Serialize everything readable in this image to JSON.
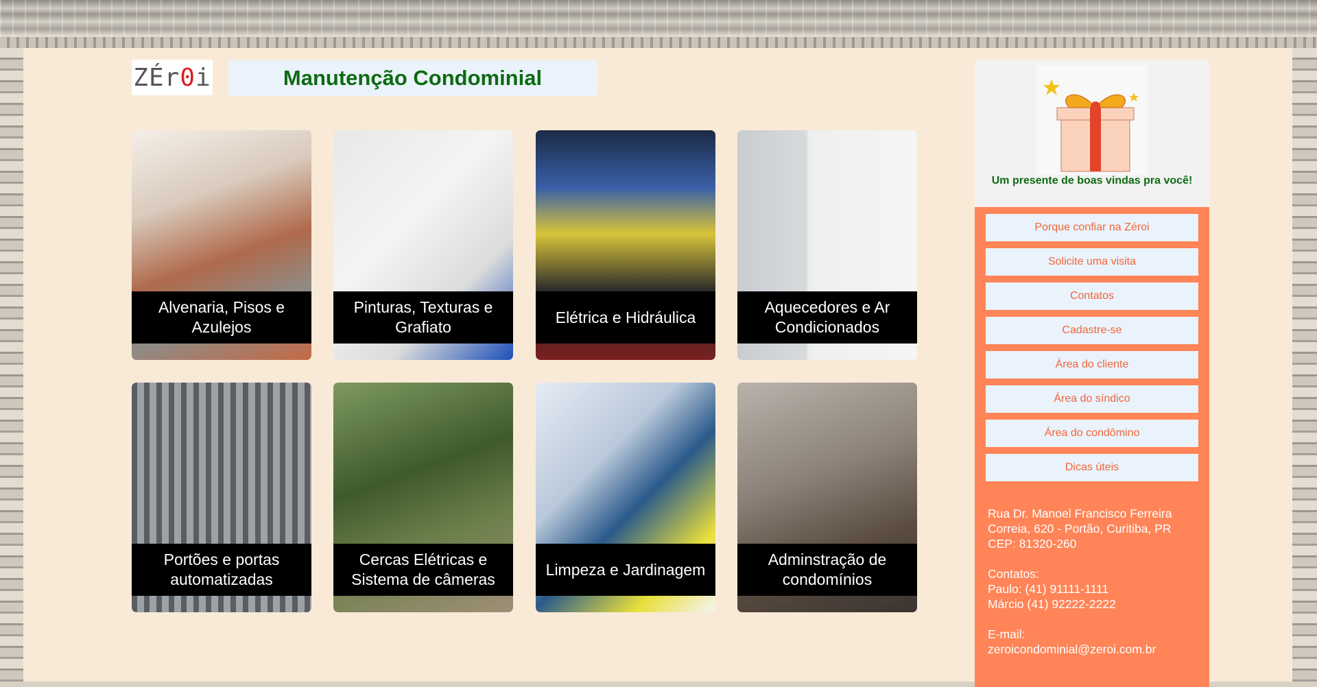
{
  "header": {
    "logo_text_pre": "ZÉr",
    "logo_text_zero": "0",
    "logo_text_post": "i",
    "title": "Manutenção Condominial"
  },
  "services": [
    {
      "label": "Alvenaria, Pisos e Azulejos"
    },
    {
      "label": "Pinturas, Texturas e Grafiato"
    },
    {
      "label": "Elétrica e Hidráulica"
    },
    {
      "label": "Aquecedores e Ar Condicionados"
    },
    {
      "label": "Portões e portas automatizadas"
    },
    {
      "label": "Cercas Elétricas e Sistema de câmeras"
    },
    {
      "label": "Limpeza e Jardinagem"
    },
    {
      "label": "Adminstração de condomínios"
    }
  ],
  "sidebar": {
    "gift_caption": "Um presente de boas vindas pra você!",
    "menu": [
      {
        "label": "Porque confiar na Zéroi"
      },
      {
        "label": "Solicite uma visita"
      },
      {
        "label": "Contatos"
      },
      {
        "label": "Cadastre-se"
      },
      {
        "label": "Área do cliente"
      },
      {
        "label": "Área do síndico"
      },
      {
        "label": "Área do condômino"
      },
      {
        "label": "Dicas úteis"
      }
    ],
    "address": {
      "line1": "Rua Dr. Manoel Francisco Ferreira",
      "line2": "Correia, 620 - Portão, Curitiba, PR",
      "line3": "CEP: 81320-260"
    },
    "contacts": {
      "heading": "Contatos:",
      "paulo": "Paulo: (41) 91111-1111",
      "marcio": "Márcio (41) 92222-2222"
    },
    "email": {
      "heading": "E-mail:",
      "value": "zeroicondominial@zeroi.com.br"
    }
  },
  "colors": {
    "page_bg": "#f9ead7",
    "title_green": "#0e6a12",
    "sidebar_orange": "#ff8457",
    "menu_text": "#f0653a",
    "menu_bg": "#eaf3fb"
  }
}
